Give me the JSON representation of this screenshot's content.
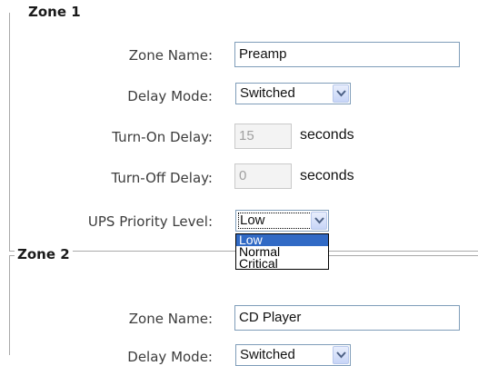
{
  "zone1": {
    "legend": "Zone 1",
    "zone_name_label": "Zone Name:",
    "zone_name_value": "Preamp",
    "delay_mode_label": "Delay Mode:",
    "delay_mode_value": "Switched",
    "turn_on_label": "Turn-On Delay:",
    "turn_on_value": "15",
    "turn_on_unit": "seconds",
    "turn_off_label": "Turn-Off Delay:",
    "turn_off_value": "0",
    "turn_off_unit": "seconds",
    "ups_label": "UPS Priority Level:",
    "ups_value": "Low",
    "ups_options": [
      "Low",
      "Normal",
      "Critical"
    ],
    "ups_highlighted": "Low"
  },
  "zone2": {
    "legend": "Zone 2",
    "zone_name_label": "Zone Name:",
    "zone_name_value": "CD Player",
    "delay_mode_label": "Delay Mode:",
    "delay_mode_value": "Switched"
  },
  "colors": {
    "selection": "#316ac5",
    "field_border": "#7f9db9",
    "disabled_bg": "#f3f3f3"
  },
  "icons": {
    "dropdown_arrow": "chevron-down-icon"
  }
}
